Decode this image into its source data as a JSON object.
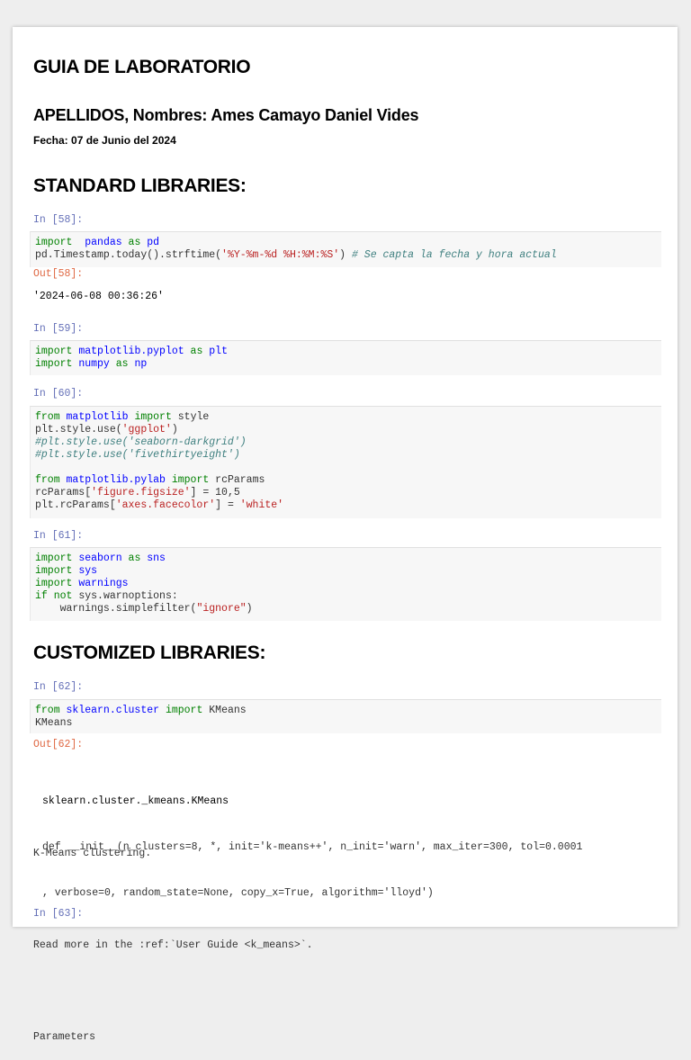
{
  "title": "GUIA DE LABORATORIO",
  "author_line": "APELLIDOS, Nombres: Ames Camayo Daniel Vides",
  "fecha_label": "Fecha:",
  "fecha_value": "07 de Junio del 2024",
  "sections": {
    "standard": "STANDARD LIBRARIES:",
    "customized": "CUSTOMIZED LIBRARIES:"
  },
  "cells": {
    "c58": {
      "prompt": "In [58]:",
      "code": [
        [
          [
            "kw",
            "import"
          ],
          [
            "",
            "  "
          ],
          [
            "nn",
            "pandas"
          ],
          [
            "",
            ""
          ],
          [
            "kw",
            " as "
          ],
          [
            "nn",
            "pd"
          ]
        ],
        [
          [
            "",
            "pd.Timestamp.today().strftime("
          ],
          [
            "s",
            "'%Y-%m-%d %H:%M:%S'"
          ],
          [
            "",
            ") "
          ],
          [
            "c",
            "# Se capta la fecha y hora actual"
          ]
        ]
      ],
      "out_prompt": "Out[58]:",
      "output": "'2024-06-08 00:36:26'"
    },
    "c59": {
      "prompt": "In [59]:",
      "code": [
        [
          [
            "kw",
            "import"
          ],
          [
            "",
            " "
          ],
          [
            "nn",
            "matplotlib.pyplot"
          ],
          [
            "kw",
            " as "
          ],
          [
            "nn",
            "plt"
          ]
        ],
        [
          [
            "kw",
            "import"
          ],
          [
            "",
            " "
          ],
          [
            "nn",
            "numpy"
          ],
          [
            "kw",
            " as "
          ],
          [
            "nn",
            "np"
          ]
        ]
      ]
    },
    "c60": {
      "prompt": "In [60]:",
      "code": [
        [
          [
            "kw",
            "from"
          ],
          [
            "",
            " "
          ],
          [
            "nn",
            "matplotlib"
          ],
          [
            "",
            " "
          ],
          [
            "kw",
            "import"
          ],
          [
            "",
            " style"
          ]
        ],
        [
          [
            "",
            "plt.style.use("
          ],
          [
            "s",
            "'ggplot'"
          ],
          [
            "",
            ")"
          ]
        ],
        [
          [
            "c",
            "#plt.style.use('seaborn-darkgrid')"
          ]
        ],
        [
          [
            "c",
            "#plt.style.use('fivethirtyeight')"
          ]
        ],
        [],
        [
          [
            "kw",
            "from"
          ],
          [
            "",
            " "
          ],
          [
            "nn",
            "matplotlib.pylab"
          ],
          [
            "",
            " "
          ],
          [
            "kw",
            "import"
          ],
          [
            "",
            " rcParams"
          ]
        ],
        [
          [
            "",
            "rcParams["
          ],
          [
            "s",
            "'figure.figsize'"
          ],
          [
            "",
            "] = 10,5"
          ]
        ],
        [
          [
            "",
            "plt.rcParams["
          ],
          [
            "s",
            "'axes.facecolor'"
          ],
          [
            "",
            "] = "
          ],
          [
            "s",
            "'white'"
          ]
        ]
      ]
    },
    "c61": {
      "prompt": "In [61]:",
      "code": [
        [
          [
            "kw",
            "import"
          ],
          [
            "",
            " "
          ],
          [
            "nn",
            "seaborn"
          ],
          [
            "kw",
            " as "
          ],
          [
            "nn",
            "sns"
          ]
        ],
        [
          [
            "kw",
            "import"
          ],
          [
            "",
            " "
          ],
          [
            "nn",
            "sys"
          ]
        ],
        [
          [
            "kw",
            "import"
          ],
          [
            "",
            " "
          ],
          [
            "nn",
            "warnings"
          ]
        ],
        [
          [
            "kw",
            "if"
          ],
          [
            "",
            " "
          ],
          [
            "kw",
            "not"
          ],
          [
            "",
            " sys.warnoptions:"
          ]
        ],
        [
          [
            "",
            "    warnings.simplefilter("
          ],
          [
            "s",
            "\"ignore\""
          ],
          [
            "",
            ")"
          ]
        ]
      ]
    },
    "c62": {
      "prompt": "In [62]:",
      "code": [
        [
          [
            "kw",
            "from"
          ],
          [
            "",
            " "
          ],
          [
            "nn",
            "sklearn.cluster"
          ],
          [
            "",
            " "
          ],
          [
            "kw",
            "import"
          ],
          [
            "",
            " KMeans"
          ]
        ],
        [
          [
            "",
            "KMeans"
          ]
        ]
      ],
      "out_prompt": "Out[62]:",
      "signature": [
        "sklearn.cluster._kmeans.KMeans",
        "def __init__(n_clusters=8, *, init='k-means++', n_init='warn', max_iter=300, tol=0.0001",
        ", verbose=0, random_state=None, copy_x=True, algorithm='lloyd')"
      ],
      "doc": [
        "K-Means clustering.",
        "",
        "Read more in the :ref:`User Guide <k_means>`.",
        "",
        "Parameters"
      ]
    },
    "c63": {
      "prompt": "In [63]:"
    }
  }
}
